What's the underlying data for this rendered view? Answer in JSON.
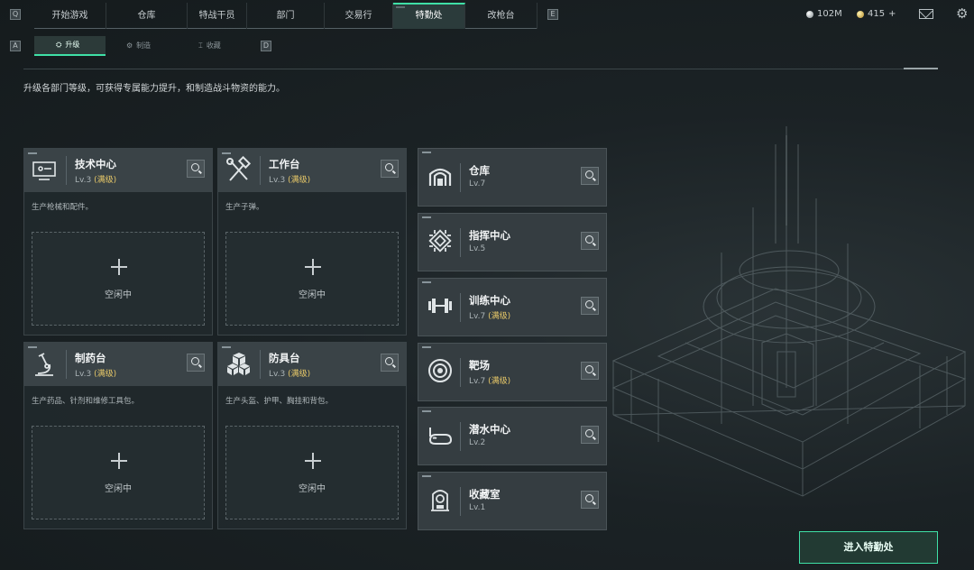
{
  "top_nav": {
    "left_key": "Q",
    "tabs": [
      {
        "label": "开始游戏"
      },
      {
        "label": "仓库"
      },
      {
        "label": "特战干员"
      },
      {
        "label": "部门"
      },
      {
        "label": "交易行"
      },
      {
        "label": "特勤处",
        "active": true
      },
      {
        "label": "改枪台"
      }
    ],
    "right_key": "E",
    "currency_silver": "102M",
    "currency_gold": "415",
    "currency_gold_plus": "+"
  },
  "sub_nav": {
    "left_key": "A",
    "tabs": [
      {
        "label": "升级",
        "icon": "upgrade-icon",
        "active": true
      },
      {
        "label": "制造",
        "icon": "craft-icon"
      },
      {
        "label": "收藏",
        "icon": "collection-icon"
      }
    ],
    "right_key": "D"
  },
  "description": "升级各部门等级，可获得专属能力提升，和制造战斗物资的能力。",
  "production_cards": [
    {
      "name": "技术中心",
      "level": "Lv.3",
      "max": "(满级)",
      "desc": "生产枪械和配件。",
      "slot": "空闲中",
      "icon": "computer-icon"
    },
    {
      "name": "工作台",
      "level": "Lv.3",
      "max": "(满级)",
      "desc": "生产子弹。",
      "slot": "空闲中",
      "icon": "tools-icon"
    },
    {
      "name": "制药台",
      "level": "Lv.3",
      "max": "(满级)",
      "desc": "生产药品、针剂和维修工具包。",
      "slot": "空闲中",
      "icon": "microscope-icon"
    },
    {
      "name": "防具台",
      "level": "Lv.3",
      "max": "(满级)",
      "desc": "生产头盔、护甲、胸挂和背包。",
      "slot": "空闲中",
      "icon": "cubes-icon"
    }
  ],
  "department_cards": [
    {
      "name": "仓库",
      "level": "Lv.7",
      "max": "",
      "icon": "warehouse-icon"
    },
    {
      "name": "指挥中心",
      "level": "Lv.5",
      "max": "",
      "icon": "chip-icon"
    },
    {
      "name": "训练中心",
      "level": "Lv.7",
      "max": "(满级)",
      "icon": "dumbbell-icon"
    },
    {
      "name": "靶场",
      "level": "Lv.7",
      "max": "(满级)",
      "icon": "target-icon"
    },
    {
      "name": "潜水中心",
      "level": "Lv.2",
      "max": "",
      "icon": "diving-mask-icon"
    },
    {
      "name": "收藏室",
      "level": "Lv.1",
      "max": "",
      "icon": "trophy-case-icon"
    }
  ],
  "enter_button": "进入特勤处",
  "colors": {
    "accent": "#3fe0a6",
    "max_level": "#e7c868",
    "background": "#1b2225"
  }
}
